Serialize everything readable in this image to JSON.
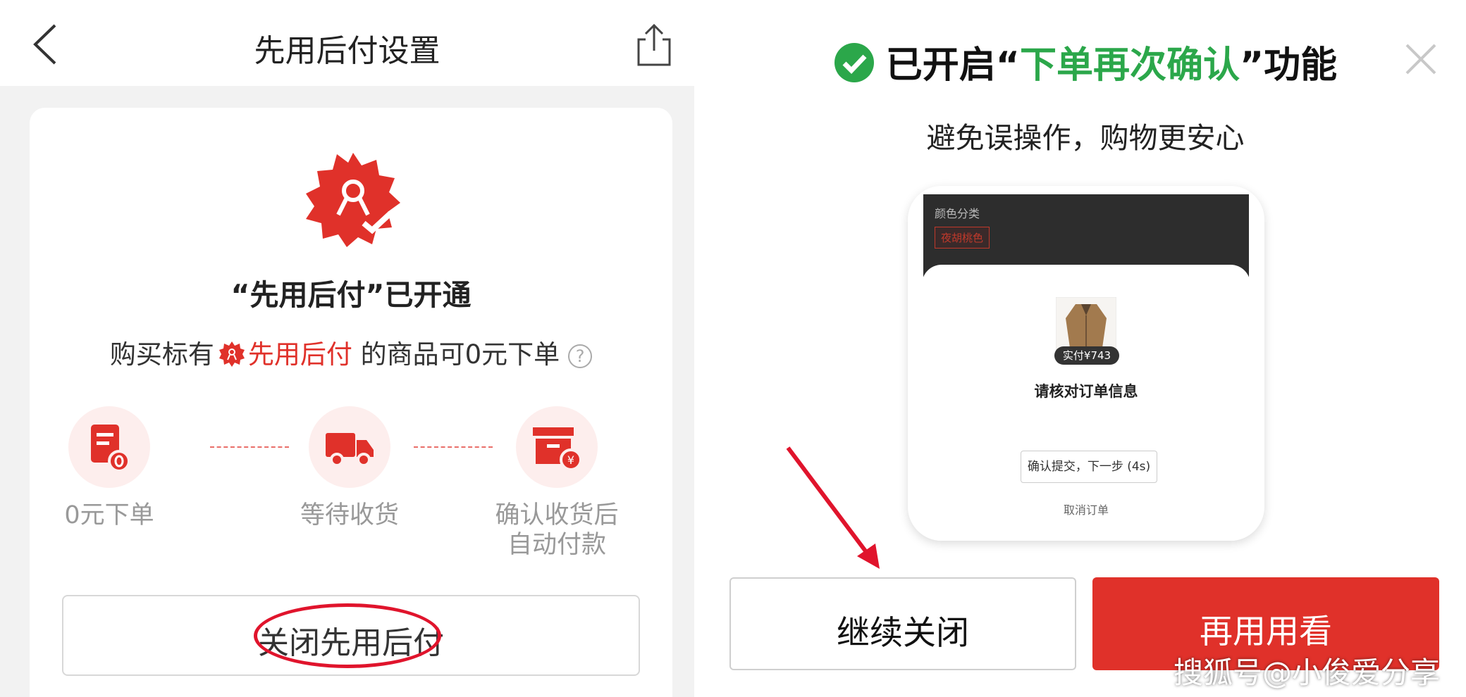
{
  "left": {
    "nav_title": "先用后付设置",
    "card_title": "“先用后付”已开通",
    "subtitle_prefix": "购买标有",
    "subtitle_highlight": "先用后付",
    "subtitle_suffix": "的商品可0元下单",
    "help_glyph": "?",
    "steps": [
      {
        "label": "0元下单"
      },
      {
        "label": "等待收货"
      },
      {
        "label_line1": "确认收货后",
        "label_line2": "自动付款"
      }
    ],
    "close_button": "关闭先用后付"
  },
  "right": {
    "title_prefix": "已开启“",
    "title_highlight": "下单再次确认",
    "title_suffix": "”功能",
    "subtitle": "避免误操作，购物更安心",
    "phone": {
      "color_label": "颜色分类",
      "color_option": "夜胡桃色",
      "price_tag": "实付¥743",
      "verify_text": "请核对订单信息",
      "confirm_button": "确认提交，下一步 (4s)",
      "cancel_link": "取消订单"
    },
    "continue_button": "继续关闭",
    "retry_button": "再用用看"
  },
  "watermark": "搜狐号@小俊爱分享",
  "colors": {
    "brand_red": "#e0312a",
    "success_green": "#2ba74a",
    "annotation_red": "#e0142c"
  },
  "icons": [
    "back-arrow-icon",
    "share-icon",
    "badge-icon",
    "order-icon",
    "truck-icon",
    "payment-box-icon",
    "check-circle-icon",
    "close-icon",
    "arrow-annotation"
  ]
}
